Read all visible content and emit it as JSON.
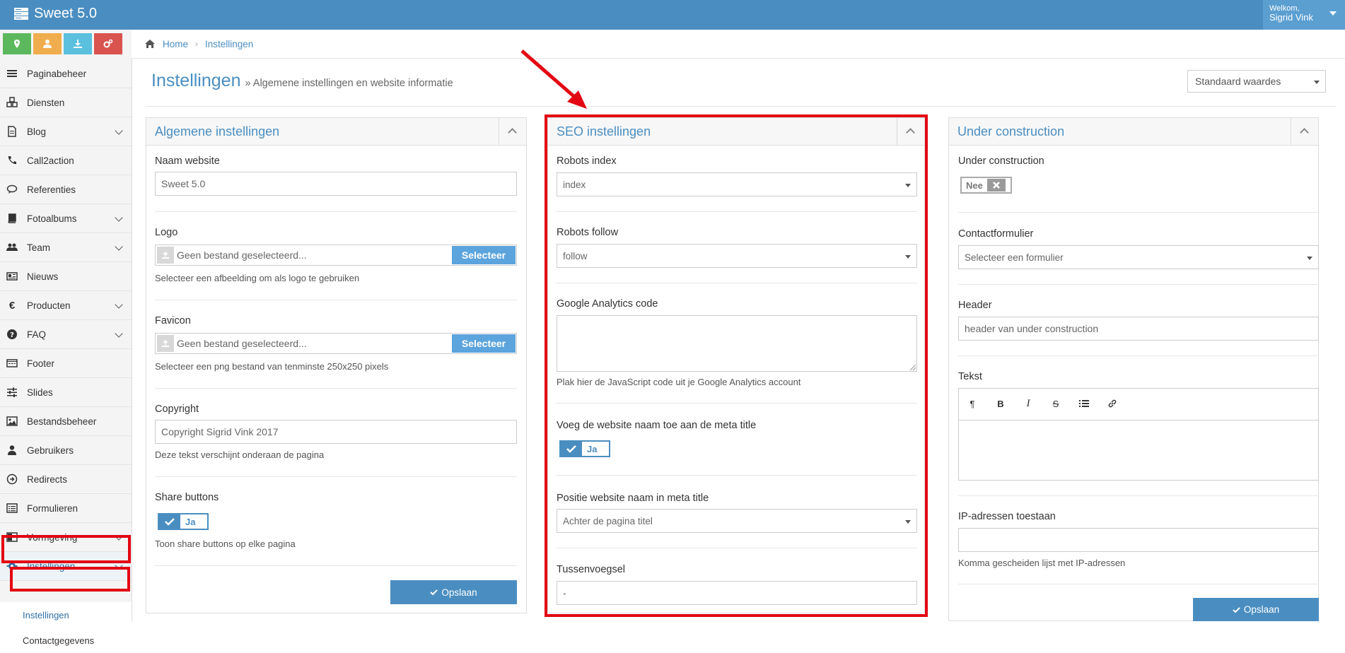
{
  "app": {
    "title": "Sweet 5.0"
  },
  "user": {
    "welcome": "Welkom,",
    "name": "Sigrid Vink"
  },
  "colors": {
    "topbar": "#4a8ec1",
    "accent": "#4a8ec1",
    "highlight": "#e30613"
  },
  "quick_buttons": [
    {
      "icon": "map-marker-icon",
      "color": "#5cb85c"
    },
    {
      "icon": "user-icon",
      "color": "#f0ad4e"
    },
    {
      "icon": "download-icon",
      "color": "#5bc0de"
    },
    {
      "icon": "cogs-icon",
      "color": "#d9534f"
    }
  ],
  "sidebar": {
    "items": [
      {
        "label": "Paginabeheer",
        "icon": "bars-icon"
      },
      {
        "label": "Diensten",
        "icon": "cubes-icon"
      },
      {
        "label": "Blog",
        "icon": "file-icon"
      },
      {
        "label": "Call2action",
        "icon": "phone-volume-icon"
      },
      {
        "label": "Referenties",
        "icon": "comment-icon"
      },
      {
        "label": "Fotoalbums",
        "icon": "book-icon"
      },
      {
        "label": "Team",
        "icon": "users-icon"
      },
      {
        "label": "Nieuws",
        "icon": "newspaper-icon"
      },
      {
        "label": "Producten",
        "icon": "euro-icon"
      },
      {
        "label": "FAQ",
        "icon": "question-circle-icon"
      },
      {
        "label": "Footer",
        "icon": "footer-icon"
      },
      {
        "label": "Slides",
        "icon": "sliders-icon"
      },
      {
        "label": "Bestandsbeheer",
        "icon": "image-icon"
      },
      {
        "label": "Gebruikers",
        "icon": "user-icon"
      },
      {
        "label": "Redirects",
        "icon": "arrow-circle-icon"
      },
      {
        "label": "Formulieren",
        "icon": "list-alt-icon"
      },
      {
        "label": "Vormgeving",
        "icon": "columns-icon"
      },
      {
        "label": "Instellingen",
        "icon": "gear-icon"
      }
    ],
    "sub_items": [
      {
        "label": "Instellingen"
      },
      {
        "label": "Contactgegevens"
      }
    ]
  },
  "breadcrumb": {
    "home": "Home",
    "current": "Instellingen"
  },
  "page": {
    "title": "Instellingen",
    "subtitle": "» Algemene instellingen en website informatie",
    "defaults_select": "Standaard waardes"
  },
  "general": {
    "title": "Algemene instellingen",
    "site_name_label": "Naam website",
    "site_name_value": "Sweet 5.0",
    "logo_label": "Logo",
    "file_placeholder": "Geen bestand geselecteerd...",
    "select_button": "Selecteer",
    "logo_help": "Selecteer een afbeelding om als logo te gebruiken",
    "favicon_label": "Favicon",
    "favicon_help": "Selecteer een png bestand van tenminste 250x250 pixels",
    "copyright_label": "Copyright",
    "copyright_value": "Copyright Sigrid Vink 2017",
    "copyright_help": "Deze tekst verschijnt onderaan de pagina",
    "share_label": "Share buttons",
    "share_toggle": "Ja",
    "share_help": "Toon share buttons op elke pagina",
    "save": "Opslaan"
  },
  "seo": {
    "title": "SEO instellingen",
    "robots_index_label": "Robots index",
    "robots_index_value": "index",
    "robots_follow_label": "Robots follow",
    "robots_follow_value": "follow",
    "ga_label": "Google Analytics code",
    "ga_help": "Plak hier de JavaScript code uit je Google Analytics account",
    "meta_label": "Voeg de website naam toe aan de meta title",
    "meta_toggle": "Ja",
    "position_label": "Positie website naam in meta title",
    "position_value": "Achter de pagina titel",
    "separator_label": "Tussenvoegsel",
    "separator_value": "-"
  },
  "uc": {
    "title": "Under construction",
    "uc_label": "Under construction",
    "uc_toggle": "Nee",
    "contact_label": "Contactformulier",
    "contact_value": "Selecteer een formulier",
    "header_label": "Header",
    "header_value": "header van under construction",
    "text_label": "Tekst",
    "editor_tools": [
      "paragraph-icon",
      "bold-icon",
      "italic-icon",
      "strikethrough-icon",
      "list-icon",
      "link-icon"
    ],
    "ip_label": "IP-adressen toestaan",
    "ip_help": "Komma gescheiden lijst met IP-adressen",
    "save": "Opslaan"
  }
}
